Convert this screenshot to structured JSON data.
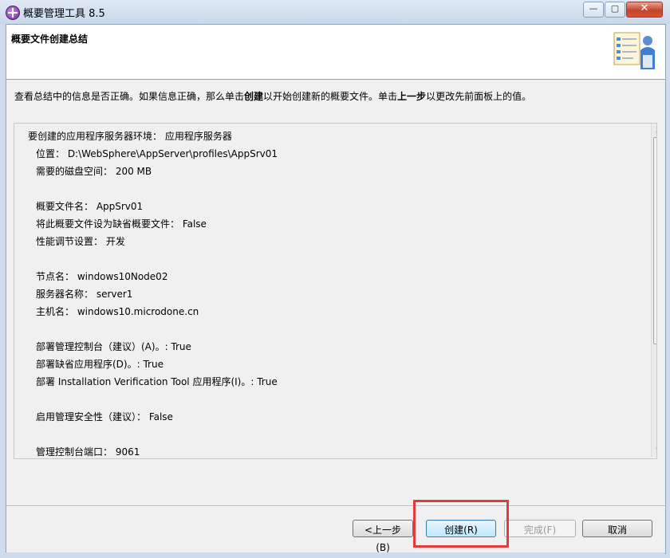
{
  "window": {
    "title": "概要管理工具 8.5",
    "minimize_icon": "minimize-icon",
    "maximize_icon": "maximize-icon",
    "close_icon": "close-icon"
  },
  "header": {
    "title": "概要文件创建总结",
    "graphic_icon": "checklist-person-icon"
  },
  "description": {
    "prefix": "查看总结中的信息是否正确。如果信息正确，那么单击",
    "create_word": "创建",
    "middle": "以开始创建新的概要文件。单击",
    "back_word": "上一步",
    "suffix": "以更改先前面板上的值。"
  },
  "summary": {
    "lines": [
      "要创建的应用程序服务器环境： 应用程序服务器",
      "位置： D:\\WebSphere\\AppServer\\profiles\\AppSrv01",
      "需要的磁盘空间： 200 MB",
      "概要文件名： AppSrv01",
      "将此概要文件设为缺省概要文件： False",
      "性能调节设置： 开发",
      "节点名： windows10Node02",
      "服务器名称： server1",
      "主机名： windows10.microdone.cn",
      "部署管理控制台（建议）(A)。: True",
      "部署缺省应用程序(D)。: True",
      "部署 Installation Verification Tool 应用程序(I)。: True",
      "启用管理安全性（建议）： False",
      "管理控制台端口： 9061"
    ]
  },
  "buttons": {
    "back": "<上一步(B)",
    "create": "创建(R)",
    "finish": "完成(F)",
    "cancel": "取消"
  },
  "colors": {
    "highlight": "#e23b3b",
    "title_bar": "#c9d8ea"
  }
}
